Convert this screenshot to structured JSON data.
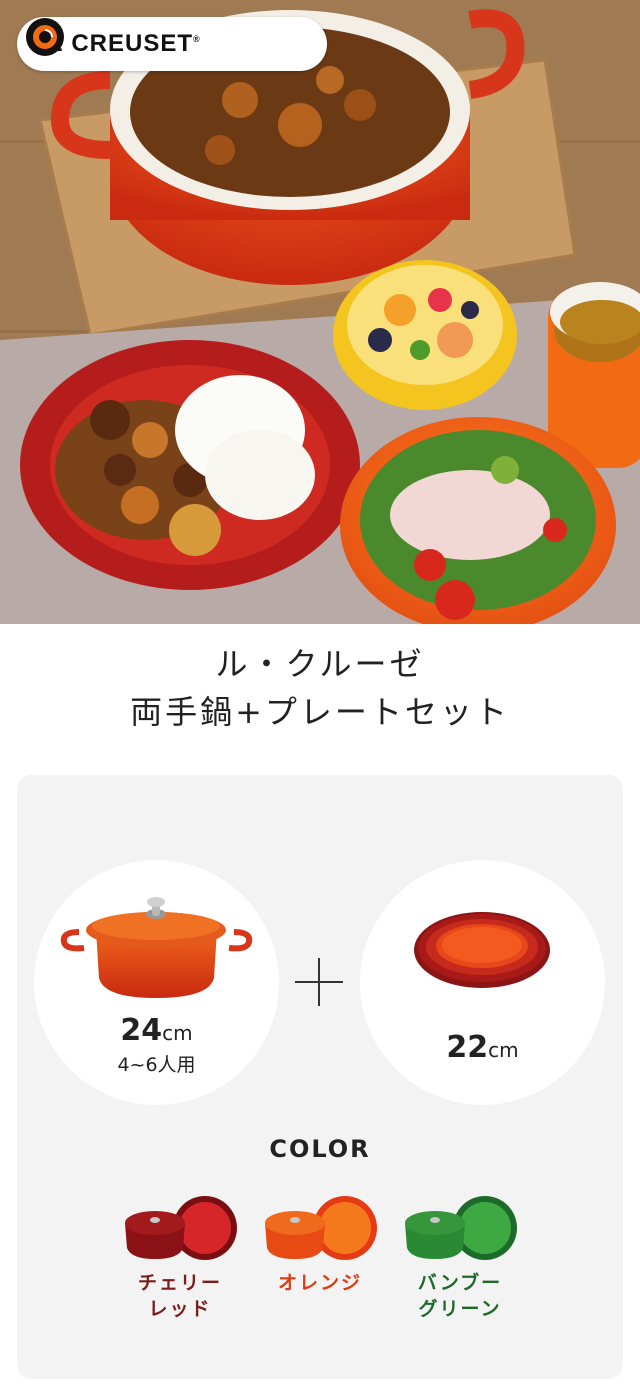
{
  "hero": {
    "brand": "LE CREUSET",
    "brand_mark": "®"
  },
  "title": {
    "line1": "ル・クルーゼ",
    "line2": "両手鍋+プレートセット"
  },
  "products": {
    "pot": {
      "size_num": "24",
      "size_unit": "cm",
      "servings": "4~6人用"
    },
    "plate": {
      "size_num": "22",
      "size_unit": "cm"
    }
  },
  "color_section": {
    "heading": "COLOR",
    "options": [
      {
        "label_line1": "チェリー",
        "label_line2": "レッド",
        "color": "#7a0f12",
        "accent": "#c0262a"
      },
      {
        "label_line1": "オレンジ",
        "label_line2": "",
        "color": "#e63b12",
        "accent": "#f47a1c"
      },
      {
        "label_line1": "バンブー",
        "label_line2": "グリーン",
        "color": "#1d6b2a",
        "accent": "#3da341"
      }
    ]
  }
}
